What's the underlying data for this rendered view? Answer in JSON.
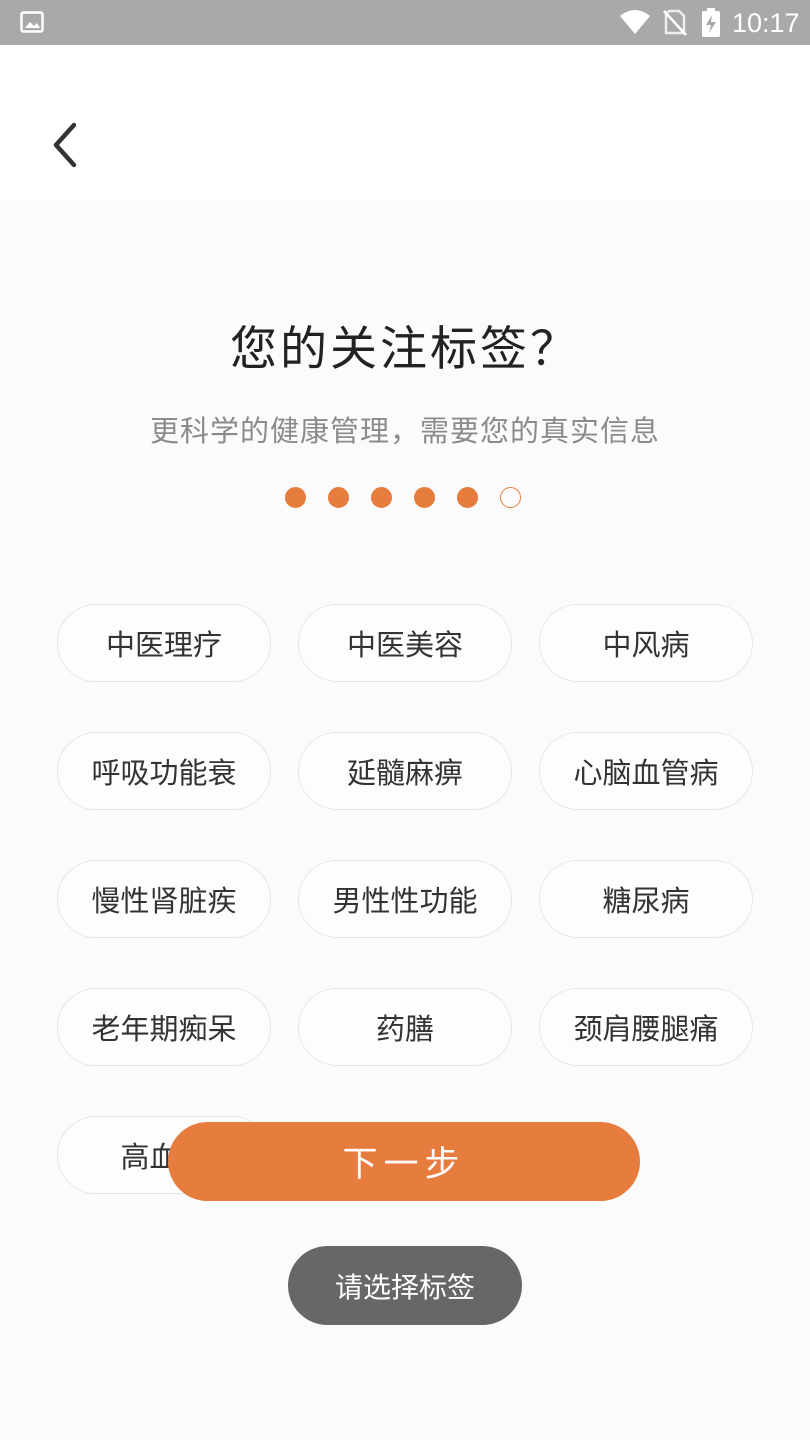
{
  "status_bar": {
    "time": "10:17",
    "icons": [
      "picture-icon",
      "wifi-icon",
      "no-sim-icon",
      "battery-charging-icon"
    ]
  },
  "header": {
    "back_icon": "chevron-left-icon"
  },
  "title": "您的关注标签？",
  "subtitle": "更科学的健康管理，需要您的真实信息",
  "progress": {
    "total_steps": 6,
    "completed_steps": 5
  },
  "tags": [
    "中医理疗",
    "中医美容",
    "中风病",
    "呼吸功能衰",
    "延髓麻痹",
    "心脑血管病",
    "慢性肾脏疾",
    "男性性功能",
    "糖尿病",
    "老年期痴呆",
    "药膳",
    "颈肩腰腿痛",
    "高血压"
  ],
  "next_button": {
    "label": "下一步"
  },
  "toast": {
    "message": "请选择标签"
  },
  "colors": {
    "accent": "#e77c3f",
    "status_bar": "#a9a9a9",
    "toast": "#676767"
  }
}
